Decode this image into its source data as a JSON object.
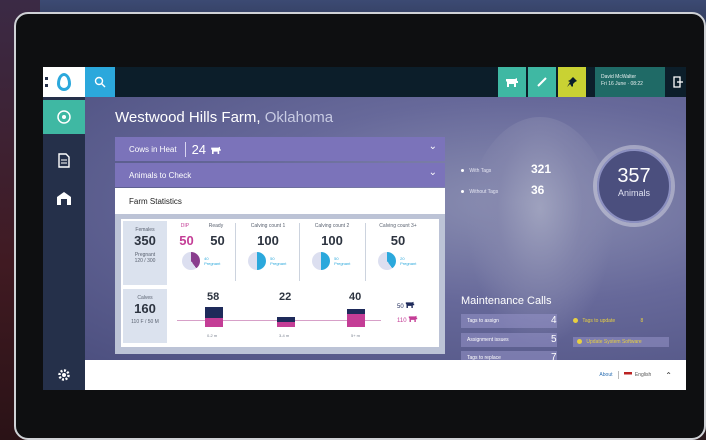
{
  "app": {
    "farm_name": "Westwood Hills Farm,",
    "farm_state": "Oklahoma",
    "user_line1": "David McWalter",
    "user_line2": "Fri 16 June · 08:22"
  },
  "sidebar": {
    "items": [
      {
        "icon": "home-icon"
      },
      {
        "icon": "document-icon"
      },
      {
        "icon": "barn-icon"
      }
    ],
    "settings_icon": "gear-icon"
  },
  "topbar": {
    "buttons": [
      {
        "icon": "cow-icon",
        "color": "#3fb8a3"
      },
      {
        "icon": "syringe-icon",
        "color": "#3fb8a3"
      },
      {
        "icon": "pin-icon",
        "color": "#c9d233"
      }
    ]
  },
  "filters": {
    "cows_in_heat_label": "Cows in Heat",
    "cows_in_heat_count": "24",
    "animals_to_check_label": "Animals to Check",
    "farm_statistics_label": "Farm Statistics"
  },
  "stats": {
    "females_label": "Females",
    "females_value": "350",
    "pregnant_label": "Pregnant",
    "pregnant_value": "120 / 300",
    "columns": [
      {
        "label_a": "DIP",
        "value_a": "50",
        "label_b": "Ready",
        "value_b": "50",
        "pie_caption": "40 Pregnant"
      },
      {
        "label": "Calving count 1",
        "value": "100",
        "pie_caption": "50 Pregnant"
      },
      {
        "label": "Calving count 2",
        "value": "100",
        "pie_caption": "50 Pregnant"
      },
      {
        "label": "Calving count 3+",
        "value": "50",
        "pie_caption": "20 Pregnant"
      }
    ],
    "calves_label": "Calves",
    "calves_value": "160",
    "calves_sub": "110 F / 50 M",
    "calf_groups": [
      {
        "value": "58",
        "scale": "0-2 m"
      },
      {
        "value": "22",
        "scale": "3-4 m"
      },
      {
        "value": "40",
        "scale": "5+ m"
      }
    ],
    "calf_legend": [
      {
        "value": "50",
        "color": "#1e2a5a"
      },
      {
        "value": "110",
        "color": "#c43d96"
      }
    ]
  },
  "tags": {
    "with_label": "With Tags",
    "with_value": "321",
    "without_label": "Without Tags",
    "without_value": "36"
  },
  "animals": {
    "total": "357",
    "label": "Animals"
  },
  "maintenance": {
    "title": "Maintenance Calls",
    "rows": [
      {
        "label": "Tags to assign",
        "value": "4"
      },
      {
        "label": "Assignment issues",
        "value": "5"
      },
      {
        "label": "Tags to replace",
        "value": "7"
      }
    ],
    "warnings": [
      {
        "label": "Tags to update",
        "value": "8"
      },
      {
        "label": "Update System Software",
        "value": ""
      }
    ]
  },
  "footer": {
    "about": "About",
    "language": "English"
  }
}
